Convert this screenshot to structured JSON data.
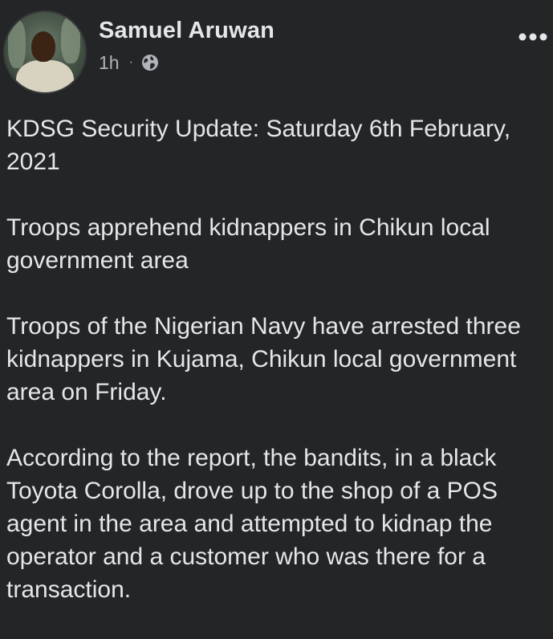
{
  "post": {
    "author": "Samuel Aruwan",
    "time": "1h",
    "separator": "·",
    "privacy_icon": "globe-icon",
    "more_icon": "more-horizontal-icon",
    "paragraphs": [
      "KDSG Security Update: Saturday 6th February, 2021",
      "Troops apprehend kidnappers in Chikun local government area",
      "Troops of the Nigerian Navy have  arrested three kidnappers in Kujama, Chikun local government area on Friday.",
      "According to the report, the bandits, in a black Toyota Corolla, drove up to the shop of a POS  agent in the area and attempted to kidnap the operator and a customer who was there for a transaction."
    ]
  },
  "colors": {
    "background": "#242526",
    "primary_text": "#e4e6eb",
    "secondary_text": "#b0b3b8"
  }
}
